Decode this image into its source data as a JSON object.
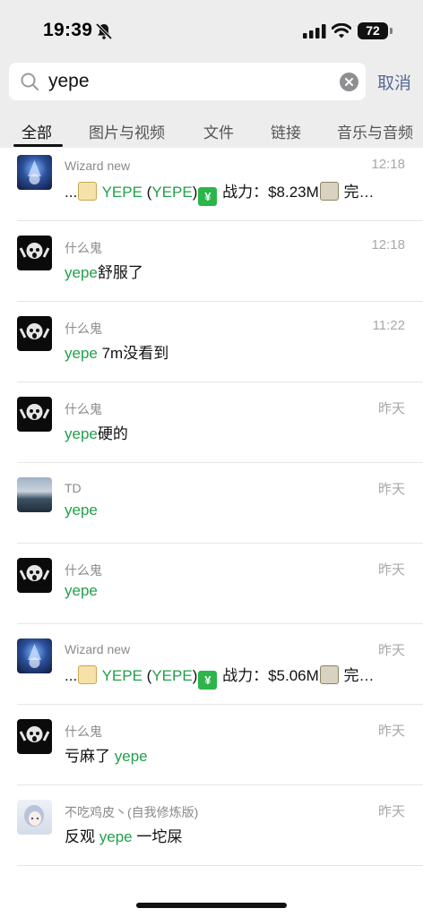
{
  "status_bar": {
    "time": "19:39",
    "battery": "72"
  },
  "search": {
    "value": "yepe",
    "cancel_label": "取消"
  },
  "tabs": [
    {
      "label": "全部",
      "active": true
    },
    {
      "label": "图片与视频"
    },
    {
      "label": "文件"
    },
    {
      "label": "链接"
    },
    {
      "label": "音乐与音频"
    }
  ],
  "results": [
    {
      "name": "Wizard new",
      "time": "12:18",
      "avatar": "wizard-avatar",
      "msg": {
        "pre": "...",
        "hl1": "YEPE",
        "mid1": " (",
        "hl2": "YEPE",
        "mid2": ")",
        "text": " 战力：$8.23M",
        "post": " 完…"
      }
    },
    {
      "name": "什么鬼",
      "time": "12:18",
      "avatar": "ghost-avatar",
      "msg": {
        "hl": "yepe",
        "text": "舒服了"
      }
    },
    {
      "name": "什么鬼",
      "time": "11:22",
      "avatar": "ghost-avatar",
      "msg": {
        "hl": "yepe",
        "text": " 7m没看到"
      }
    },
    {
      "name": "什么鬼",
      "time": "昨天",
      "avatar": "ghost-avatar",
      "msg": {
        "hl": "yepe",
        "text": "硬的"
      }
    },
    {
      "name": "TD",
      "time": "昨天",
      "avatar": "landscape-avatar",
      "msg": {
        "hl": "yepe",
        "text": ""
      }
    },
    {
      "name": "什么鬼",
      "time": "昨天",
      "avatar": "ghost-avatar",
      "msg": {
        "hl": "yepe",
        "text": ""
      }
    },
    {
      "name": "Wizard new",
      "time": "昨天",
      "avatar": "wizard-avatar",
      "msg": {
        "pre": "...",
        "hl1": "YEPE",
        "mid1": " (",
        "hl2": "YEPE",
        "mid2": ")",
        "text": " 战力：$5.06M",
        "post": " 完…"
      }
    },
    {
      "name": "什么鬼",
      "time": "昨天",
      "avatar": "ghost-avatar",
      "msg": {
        "before": "亏麻了 ",
        "hl": "yepe"
      }
    },
    {
      "name": "不吃鸡皮丶(自我修炼版)",
      "time": "昨天",
      "avatar": "anime-girl-avatar",
      "msg": {
        "before": "反观 ",
        "hl": "yepe",
        "text": " 一坨屎"
      }
    }
  ],
  "colors": {
    "highlight": "#21a04b",
    "cancel": "#576b95",
    "header_bg": "#ededed"
  }
}
